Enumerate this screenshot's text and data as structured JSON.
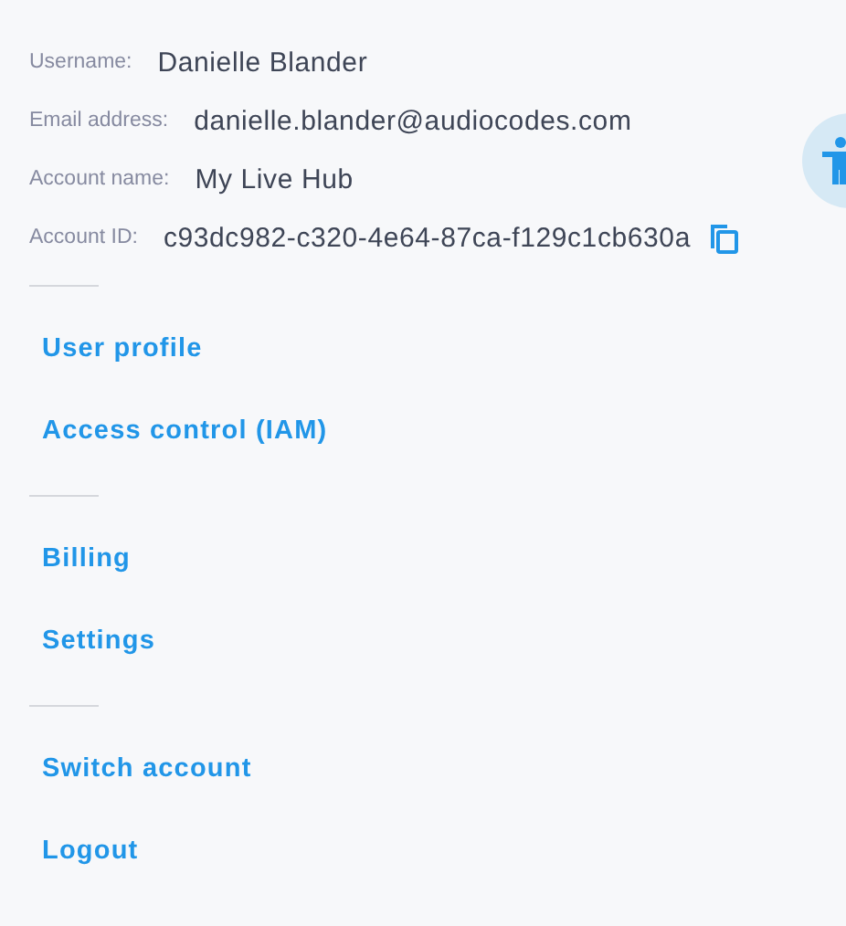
{
  "account_info": [
    {
      "label": "Username:",
      "value": "Danielle Blander"
    },
    {
      "label": "Email address:",
      "value": "danielle.blander@audiocodes.com"
    },
    {
      "label": "Account name:",
      "value": "My Live Hub"
    },
    {
      "label": "Account ID:",
      "value": "c93dc982-c320-4e64-87ca-f129c1cb630a",
      "copyable": true
    }
  ],
  "menu_groups": [
    {
      "items": [
        "User profile",
        "Access control (IAM)"
      ]
    },
    {
      "items": [
        "Billing",
        "Settings"
      ]
    },
    {
      "items": [
        "Switch account",
        "Logout"
      ]
    }
  ]
}
